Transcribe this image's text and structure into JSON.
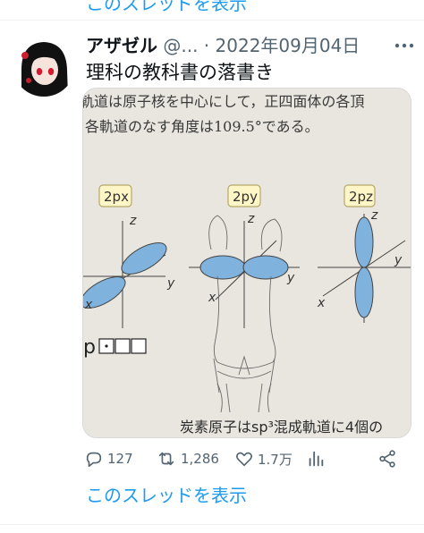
{
  "top_link": {
    "label": "このスレッドを表示"
  },
  "tweet": {
    "author_name": "アザゼル",
    "author_handle": "@...",
    "separator": "·",
    "date": "2022年09月04日",
    "text": "理科の教科書の落書き",
    "photo": {
      "line1": "軌道は原子核を中心にして，正四面体の各頂",
      "line2": "各軌道のなす角度は109.5°である。",
      "labels": {
        "px": "2px",
        "py": "2py",
        "pz": "2pz"
      },
      "axis": {
        "x": "x",
        "y": "y",
        "z": "z"
      },
      "p_label": "p",
      "bottom_text": "炭素原子はsp³混成軌道に4個の"
    },
    "actions": {
      "reply_count": "127",
      "retweet_count": "1,286",
      "like_count": "1.7万"
    }
  },
  "thread_link": {
    "label": "このスレッドを表示"
  },
  "colors": {
    "accent": "#1d9bf0",
    "muted": "#536471",
    "lobe": "#7fb2dc"
  },
  "icons": [
    "more-icon",
    "reply-icon",
    "retweet-icon",
    "like-icon",
    "analytics-icon",
    "share-icon"
  ]
}
